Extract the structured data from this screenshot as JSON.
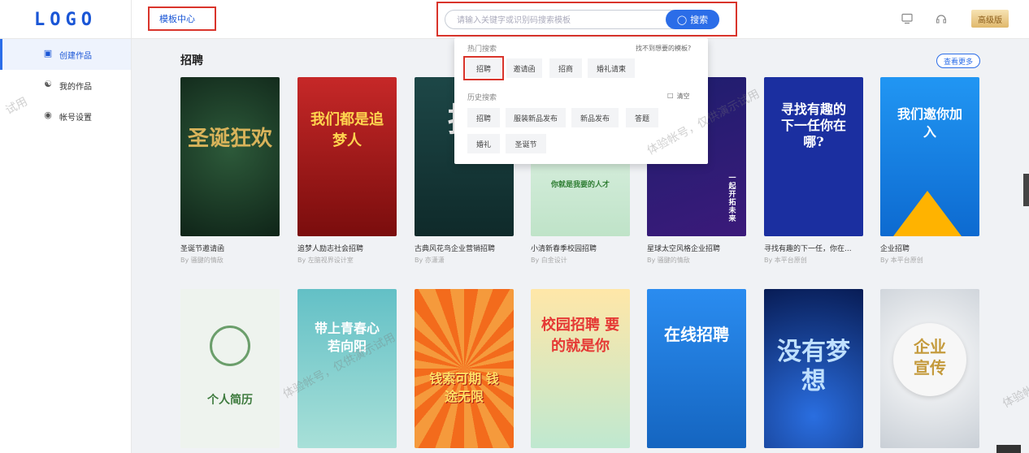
{
  "header": {
    "logo": "LOGO",
    "template_center": "模板中心",
    "search_placeholder": "请输入关键字或识别码搜索模板",
    "search_button": "搜索",
    "pro_label": "高级版"
  },
  "sidebar": {
    "items": [
      {
        "label": "创建作品",
        "icon": "create-icon",
        "active": true
      },
      {
        "label": "我的作品",
        "icon": "user-icon",
        "active": false
      },
      {
        "label": "帐号设置",
        "icon": "settings-icon",
        "active": false
      }
    ]
  },
  "main": {
    "section_title": "招聘",
    "see_more": "查看更多",
    "row1": [
      {
        "name": "圣诞节邀请函",
        "by": "By 骚腱的情敌",
        "headline": "圣诞狂欢",
        "color": "#1f3a2a",
        "accent": "#d8b35a"
      },
      {
        "name": "追梦人励志社会招聘",
        "by": "By 左脑视界设计室",
        "headline": "我们都是追梦人",
        "color": "#b71c1c",
        "accent": "#ffd54f"
      },
      {
        "name": "古典风花鸟企业营销招聘",
        "by": "By 亦潇潇",
        "headline": "招",
        "color": "#163a3a",
        "accent": "#e0e0e0"
      },
      {
        "name": "小清新春季校园招聘",
        "by": "By 白金设计",
        "headline": "你就是我要的人才",
        "color": "#dff3e4",
        "accent": "#4caf50"
      },
      {
        "name": "星球太空风格企业招聘",
        "by": "By 骚腱的情敌",
        "headline": "一起开拓未来",
        "color": "#1a1a5e",
        "accent": "#19c3b3"
      },
      {
        "name": "寻找有趣的下一任，你在...",
        "by": "By 本平台原创",
        "headline": "寻找有趣的下一任你在哪?",
        "color": "#1b2fa0",
        "accent": "#ff7a45"
      },
      {
        "name": "企业招聘",
        "by": "By 本平台原创",
        "headline": "我们邀你加入",
        "color": "#1e88e5",
        "accent": "#ffb300"
      }
    ],
    "row2": [
      {
        "headline": "个人简历",
        "color": "#eef3ee",
        "accent": "#3d7a3d"
      },
      {
        "headline": "带上青春心若向阳",
        "color": "#6cc3c8",
        "accent": "#ffffff"
      },
      {
        "headline": "钱索可期 钱途无限",
        "color": "#f36b1c",
        "accent": "#ffe066"
      },
      {
        "headline": "校园招聘 要的就是你",
        "color": "#ffe7a8",
        "accent": "#e53935"
      },
      {
        "headline": "在线招聘",
        "color": "#1f7ee0",
        "accent": "#ffffff"
      },
      {
        "headline": "没有梦想",
        "color": "#0d2a7a",
        "accent": "#9fd0ff"
      },
      {
        "headline": "企业宣传",
        "color": "#e4e7ea",
        "accent": "#c49a3c"
      }
    ]
  },
  "dropdown": {
    "hot_label": "热门搜索",
    "not_found_link": "找不到想要的模板?",
    "hot_tags": [
      "招聘",
      "邀请函",
      "招商",
      "婚礼请柬"
    ],
    "history_label": "历史搜索",
    "clear_label": "清空",
    "history_tags": [
      "招聘",
      "服装新品发布",
      "新品发布",
      "答题",
      "婚礼",
      "圣诞节"
    ]
  },
  "watermarks": [
    "试用",
    "体验帐号，仅供演示试用",
    "体验帐号，仅供演示试用",
    "体验帐"
  ]
}
